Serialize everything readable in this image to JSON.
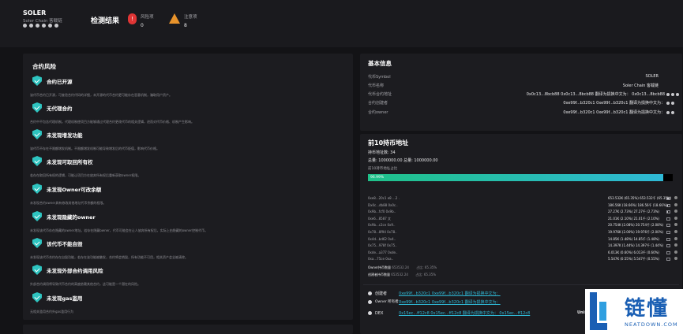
{
  "header": {
    "token_name": "SOLER",
    "token_sub": "Soler Chain 客载链",
    "result_title": "检测结果",
    "risk_label": "风险项",
    "risk_count": "0",
    "warn_label": "注意项",
    "warn_count": "8"
  },
  "contract_risk": {
    "title": "合约风险",
    "items": [
      {
        "title": "合约已开源",
        "desc": "该代币合约已开源，可查验合约代码的详细，未开源的代币合约更可能存在恶意机制，骗取用户资产。"
      },
      {
        "title": "无代理合约",
        "desc": "合约中不包含代理机制。代理机制使项目方能够通过代理合约更改代币的相关逻辑，进而对代币价格、机制产生影响。"
      },
      {
        "title": "未发现增发功能",
        "desc": "该代币不存在不限额增发机制。不限额增发机制可能导致增发后的代币贬值，影响代币价格。"
      },
      {
        "title": "未发现可取回所有权",
        "desc": "若存在取回所有权的逻辑，可能让项目方在放弃所有权后重新获取owner权限。"
      },
      {
        "title": "未发现Owner可改余额",
        "desc": "未发现合约owner具有修改其他地址代币余额的权限。"
      },
      {
        "title": "未发现隐藏的owner",
        "desc": "未发现该代币存在隐藏的owner地址。若存在隐藏owner，代币可能会在让人放弃所有权后，实际上由隐藏的owner控制代币。"
      },
      {
        "title": "该代币不能自毁",
        "desc": "未发现该代币合约存在自毁功能，若存在该功能被触发，合约将会销毁，所有功能不可用，相关资产会全被清除。"
      },
      {
        "title": "未发现外部合约调用风险",
        "desc": "外部合约调用将导致代币合约的高度依赖其他合约，这可能是一个潜在的风险。"
      },
      {
        "title": "未发现gas滥用",
        "desc": "无相关滥用合约外gas滥用行为"
      }
    ]
  },
  "basic_info": {
    "title": "基本信息",
    "rows": [
      {
        "key": "代币Symbol",
        "value": "SOLER"
      },
      {
        "key": "代币名称",
        "value": "Soler Chain 客载链"
      },
      {
        "key": "代币合约地址",
        "value": "0x0c13...8bcb88 0x0c13...8bcb88 翻译为损换中文为： 0x0c13...8bcb88"
      },
      {
        "key": "合约创建者",
        "value": "0xe99f...b320c1 0xe99f...b320c1 翻译为损换中文为："
      },
      {
        "key": "合约owner",
        "value": "0xe99f...b320c1 0xe99f...b320c1 翻译为损换中文为："
      }
    ]
  },
  "holders": {
    "title": "前10持币地址",
    "count_label": "持币地址数: 34",
    "total_label": "总量: 1000000.00 总量: 1000000.00",
    "top10_label": "前10持币地址占比",
    "top10_percent": 96.99,
    "top10_text": "96.99%",
    "rows": [
      {
        "addr": "0xe8...20c1 e8 ...2 .",
        "value": "653.532K (65.35%)  653.532千 (65.35%)",
        "pct": 65.35
      },
      {
        "addr": "Dx0c...db88 0x0c..",
        "value": "186.56K (18.66%)  186.56千 (18.66%)",
        "pct": 18.66
      },
      {
        "addr": "0x9b...fcf0 0x9b..",
        "value": "27.27K (2.73%)  27.27千 (2.73%)",
        "pct": 2.73
      },
      {
        "addr": "0xe6...8587 文",
        "value": "21.01K (2.10%)  21.01千 (2.10%)",
        "pct": 2.1
      },
      {
        "addr": "0x9b...c2ce 0x9..",
        "value": "20.754K (2.08%)  20.754千 (2.08%)",
        "pct": 2.08
      },
      {
        "addr": "0x78...8f94 0x78..",
        "value": "19.976K (2.00%)  19.976千 (2.00%)",
        "pct": 2.0
      },
      {
        "addr": "0x4d...bd62 0x4..",
        "value": "14.85K (1.48%)  14.85千 (1.48%)",
        "pct": 1.48
      },
      {
        "addr": "0x75...978f 0x75..",
        "value": "14.397K (1.44%)  14.397千 (1.44%)",
        "pct": 1.44
      },
      {
        "addr": "0xde...a377 0xde..",
        "value": "6.013K (0.60%)  6.013千 (0.60%)",
        "pct": 0.6
      },
      {
        "addr": "0xa...75ce 0xa..",
        "value": "5.547K (0.55%)  5.547千 (0.55%)",
        "pct": 0.55
      }
    ],
    "owner_amount_label": "Owner持币数量",
    "owner_amount": "653532.24",
    "owner_amount_pct": "占比: 65.35%",
    "creator_amount_label": "创建者持币数量",
    "creator_amount": "653532.24",
    "creator_amount_pct": "占比: 65.35%"
  },
  "footer_info": {
    "creator_label": "创建者",
    "creator_value": "0xe99f...b320c1 0xe99f...b320c1 翻译为损换中文为：",
    "owner_label": "Owner 所有者",
    "owner_value": "0xe99f...b320c1 0xe99f...b320c1 翻译为损换中文为：",
    "dex_label": "DEX",
    "dex_value": "0x15ec...ff12c8 0x15ec...ff12c8 翻译为损换中文为： 0x15ec...ff12c8",
    "dex_suffix": "Unis"
  },
  "brand": {
    "cn": "链懂",
    "en": "NEATDOWN.COM"
  }
}
